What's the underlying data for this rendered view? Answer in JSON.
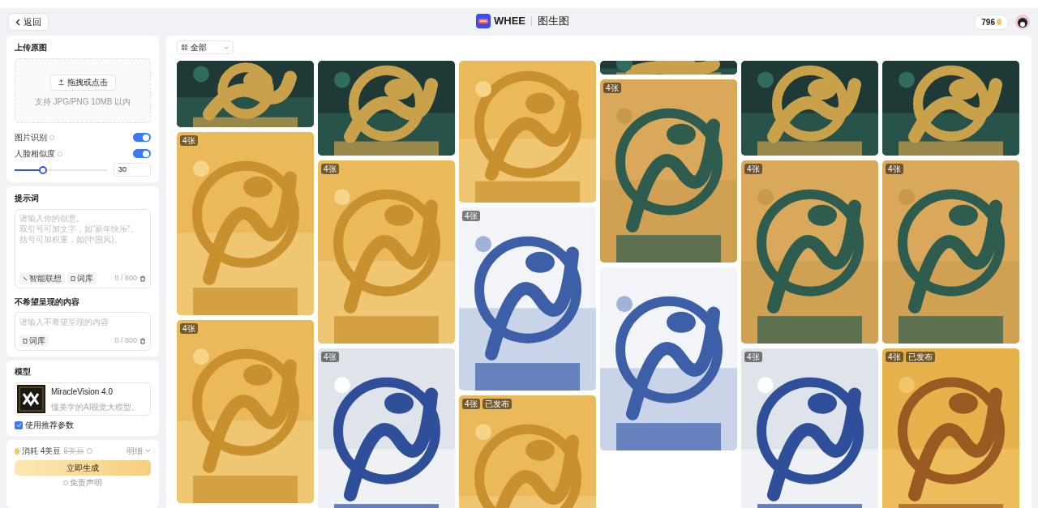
{
  "header": {
    "back": "返回",
    "app_name": "WHEE",
    "page_title": "图生图",
    "credits": "796"
  },
  "upload": {
    "title": "上传原图",
    "button": "拖拽或点击",
    "hint": "支持 JPG/PNG 10MB 以内",
    "toggles": [
      {
        "label": "图片识别",
        "on": true
      },
      {
        "label": "人脸相似度",
        "on": true
      }
    ],
    "slider": {
      "level": 0.3,
      "value": "30"
    }
  },
  "prompt": {
    "title": "提示词",
    "placeholder": [
      "请输入你的创意。",
      "双引号可加文字，如“新年快乐”。",
      "括号可加权重，如(中国风)。"
    ],
    "chips": [
      "智能联想",
      "词库"
    ],
    "count": "0 / 800"
  },
  "negative": {
    "title": "不希望呈现的内容",
    "placeholder": "请输入不希望呈现的内容",
    "chips": [
      "词库"
    ],
    "count": "0 / 800"
  },
  "model": {
    "title": "模型",
    "name": "MiracleVision 4.0",
    "desc": "懂美学的AI视觉大模型。",
    "recommended_label": "使用推荐参数",
    "recommended": true
  },
  "generate": {
    "cost": "消耗 4美豆",
    "original_cost": "8美豆",
    "details": "明细",
    "button": "立即生成",
    "disclaimer": "免责声明"
  },
  "filter": {
    "label": "全部"
  },
  "gallery": [
    [
      {
        "kind": "picture"
      },
      {
        "kind": "picture",
        "badges": [
          "4张"
        ]
      },
      {
        "kind": "picture",
        "badges": [
          "4张"
        ]
      }
    ],
    [
      {
        "kind": "picture"
      },
      {
        "kind": "picture",
        "badges": [
          "4张"
        ]
      },
      {
        "kind": "picture",
        "badges": [
          "4张"
        ]
      }
    ],
    [
      {
        "kind": "picture"
      },
      {
        "kind": "picture",
        "badges": [
          "4张"
        ]
      },
      {
        "kind": "picture",
        "badges": [
          "4张",
          "已发布"
        ]
      }
    ],
    [
      {
        "kind": "picture"
      },
      {
        "kind": "picture",
        "badges": [
          "4张"
        ]
      },
      {
        "kind": "picture"
      }
    ],
    [
      {
        "kind": "picture"
      },
      {
        "kind": "picture",
        "badges": [
          "4张"
        ]
      },
      {
        "kind": "picture",
        "badges": [
          "4张"
        ]
      }
    ],
    [
      {
        "kind": "picture"
      },
      {
        "kind": "picture",
        "badges": [
          "4张"
        ]
      },
      {
        "kind": "picture",
        "badges": [
          "4张",
          "已发布"
        ]
      }
    ]
  ]
}
